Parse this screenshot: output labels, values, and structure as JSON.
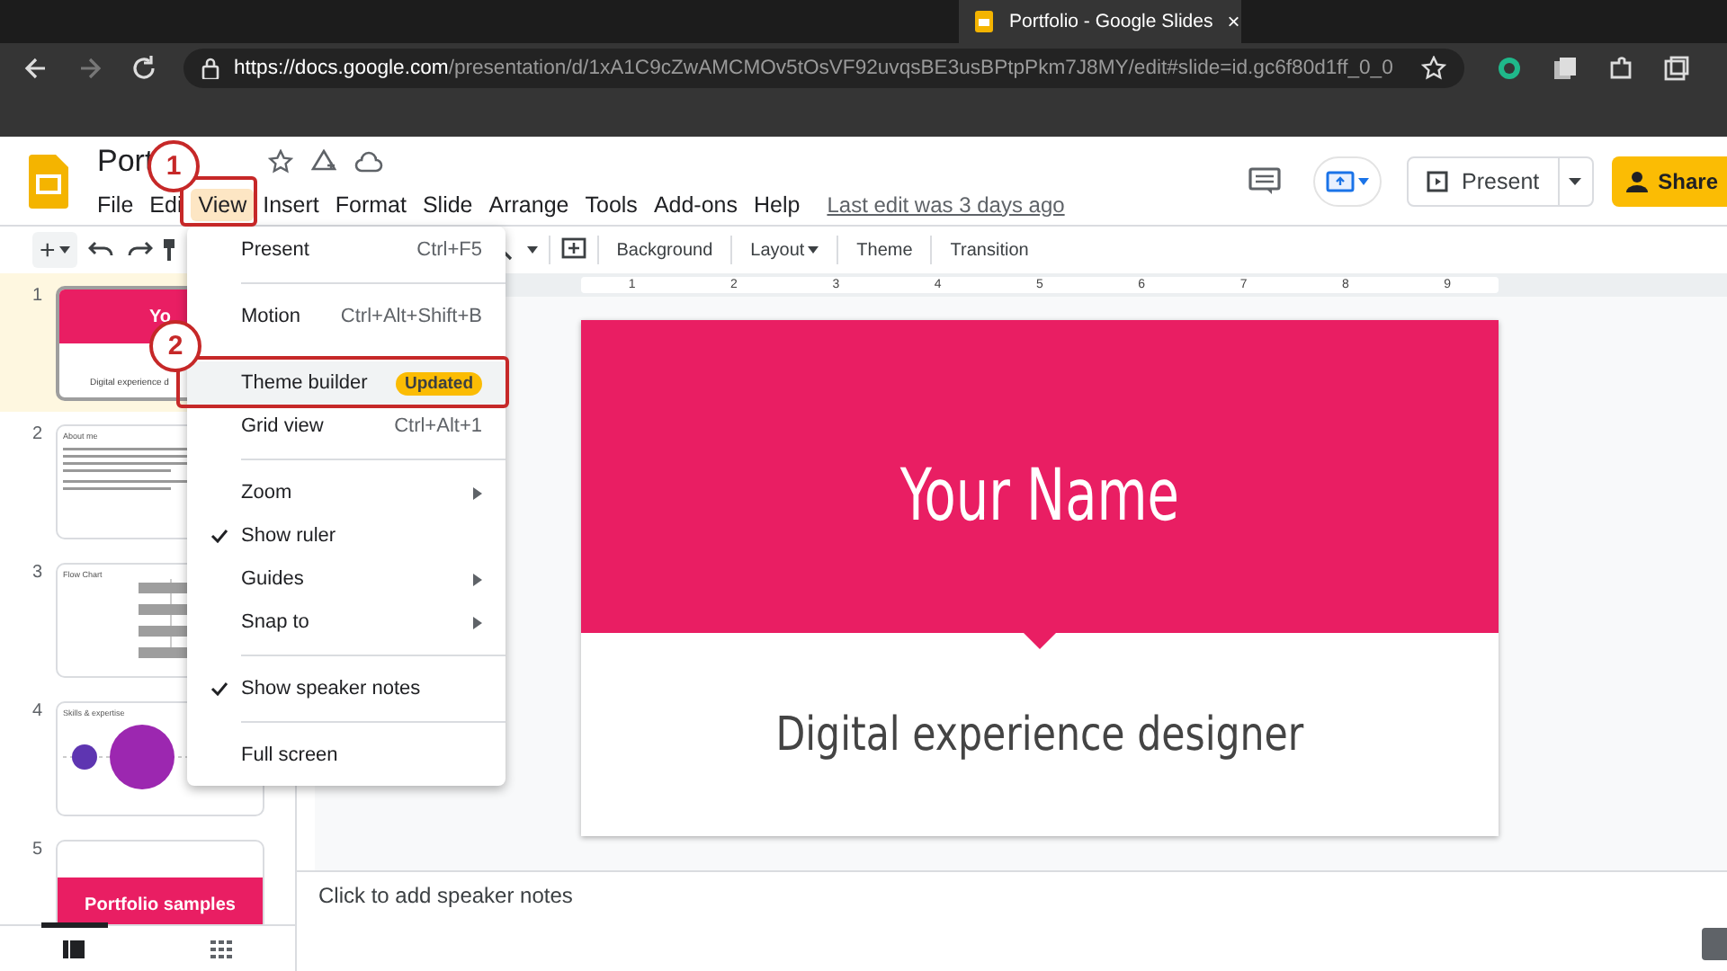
{
  "browser": {
    "tab_title": "Portfolio - Google Slides",
    "tab_close": "×",
    "url_host": "https://docs.google.com",
    "url_path": "/presentation/d/1xA1C9cZwAMCMOv5tOsVF92uvqsBE3usBPtpPkm7J8MY/edit#slide=id.gc6f80d1ff_0_0"
  },
  "header": {
    "title": "Port",
    "menus": [
      {
        "label": "File",
        "selected": false
      },
      {
        "label": "Edi",
        "selected": false
      },
      {
        "label": "View",
        "selected": true
      },
      {
        "label": "Insert",
        "selected": false
      },
      {
        "label": "Format",
        "selected": false
      },
      {
        "label": "Slide",
        "selected": false
      },
      {
        "label": "Arrange",
        "selected": false
      },
      {
        "label": "Tools",
        "selected": false
      },
      {
        "label": "Add-ons",
        "selected": false
      },
      {
        "label": "Help",
        "selected": false
      }
    ],
    "last_edit": "Last edit was 3 days ago",
    "present": "Present",
    "share": "Share"
  },
  "toolbar": {
    "add": "+",
    "items": [
      "Background",
      "Layout",
      "Theme",
      "Transition"
    ]
  },
  "ruler": {
    "labels": [
      "1",
      "2",
      "3",
      "4",
      "5",
      "6",
      "7",
      "8",
      "9"
    ]
  },
  "slides": [
    {
      "number": "1",
      "kind": "title",
      "selected": true,
      "texts": [
        "Yo",
        "Digital experience d"
      ]
    },
    {
      "number": "2",
      "kind": "text",
      "selected": false,
      "texts": [
        "About me"
      ]
    },
    {
      "number": "3",
      "kind": "chart",
      "selected": false,
      "texts": [
        "Flow Chart"
      ]
    },
    {
      "number": "4",
      "kind": "circles",
      "selected": false,
      "texts": [
        "Skills & expertise"
      ]
    },
    {
      "number": "5",
      "kind": "section",
      "selected": false,
      "texts": [
        "Portfolio samples"
      ]
    }
  ],
  "slide": {
    "title": "Your Name",
    "subtitle": "Digital experience designer"
  },
  "notes": {
    "placeholder": "Click to add speaker notes"
  },
  "view_menu": {
    "items": [
      {
        "kind": "item",
        "label": "Present",
        "shortcut": "Ctrl+F5",
        "checked": false,
        "submenu": false
      },
      {
        "kind": "divider"
      },
      {
        "kind": "item",
        "label": "Motion",
        "shortcut": "Ctrl+Alt+Shift+B",
        "checked": false,
        "submenu": false
      },
      {
        "kind": "item",
        "label": "Theme builder",
        "badge": "Updated",
        "checked": false,
        "submenu": false
      },
      {
        "kind": "item",
        "label": "Grid view",
        "shortcut": "Ctrl+Alt+1",
        "checked": false,
        "submenu": false
      },
      {
        "kind": "divider"
      },
      {
        "kind": "item",
        "label": "Zoom",
        "checked": false,
        "submenu": true
      },
      {
        "kind": "item",
        "label": "Show ruler",
        "checked": true,
        "submenu": false
      },
      {
        "kind": "item",
        "label": "Guides",
        "checked": false,
        "submenu": true
      },
      {
        "kind": "item",
        "label": "Snap to",
        "checked": false,
        "submenu": true
      },
      {
        "kind": "divider"
      },
      {
        "kind": "item",
        "label": "Show speaker notes",
        "checked": true,
        "submenu": false
      },
      {
        "kind": "divider"
      },
      {
        "kind": "item",
        "label": "Full screen",
        "checked": false,
        "submenu": false
      }
    ]
  },
  "callouts": [
    {
      "number": "1"
    },
    {
      "number": "2"
    }
  ]
}
